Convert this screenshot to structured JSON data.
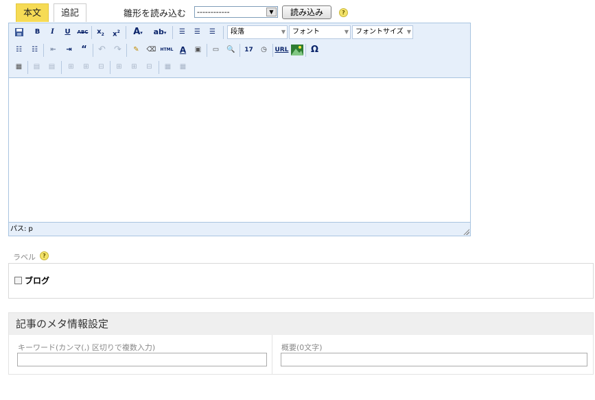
{
  "tabs": [
    {
      "label": "本文",
      "active": true
    },
    {
      "label": "追記",
      "active": false
    }
  ],
  "template": {
    "label": "雛形を読み込む",
    "selected": "------------",
    "load_button": "読み込み",
    "help": "?"
  },
  "editor": {
    "format_select": "段落",
    "font_select": "フォント",
    "fontsize_select": "フォントサイズ",
    "html_icon_text": "HTML",
    "url_icon_text": "URL",
    "status_path": "パス: p"
  },
  "label_section": {
    "title": "ラベル",
    "help": "?",
    "items": [
      {
        "label": "ブログ",
        "checked": false
      }
    ]
  },
  "meta": {
    "title": "記事のメタ情報設定",
    "keywords_label": "キーワード(カンマ(,) 区切りで複数入力)",
    "keywords_value": "",
    "summary_label": "概要(0文字)",
    "summary_value": ""
  },
  "colors": {
    "tab_active": "#f6db55",
    "toolbar_bg": "#e6effa",
    "border_blue": "#a8c4e0",
    "meta_header_bg": "#efefef"
  }
}
